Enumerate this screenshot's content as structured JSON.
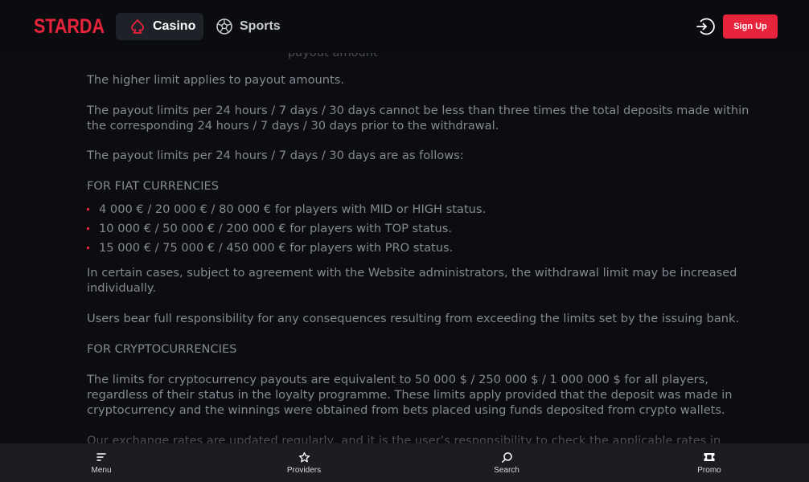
{
  "brand": {
    "logo_text": "STARDA",
    "accent": "#e8243c"
  },
  "header": {
    "tabs": [
      {
        "label": "Casino",
        "icon": "spade-icon",
        "active": true
      },
      {
        "label": "Sports",
        "icon": "soccer-ball-icon",
        "active": false
      }
    ],
    "login_icon": "login-icon",
    "signup_label": "Sign Up"
  },
  "content": {
    "partial_top_line": "payout amount",
    "p_higher_limit": "The higher limit applies to payout amounts.",
    "p_not_less_line1": "The payout limits per 24 hours / 7 days / 30 days cannot be less than three times the total deposits made within",
    "p_not_less_line2": "the corresponding 24 hours / 7 days / 30 days prior to the withdrawal.",
    "p_as_follows": "The payout limits per 24 hours / 7 days / 30 days are as follows:",
    "fiat_heading": "FOR FIAT CURRENCIES",
    "fiat_items": [
      "4 000 € / 20 000 € / 80 000 € for players with MID or HIGH status.",
      "10 000 € / 50 000 € / 200 000 € for players with TOP status.",
      "15 000 € / 75 000 € / 450 000 € for players with PRO status."
    ],
    "p_certain_cases_line1": "In certain cases, subject to agreement with the Website administrators, the withdrawal limit may be increased",
    "p_certain_cases_line2": "individually.",
    "p_users_bear": "Users bear full responsibility for any consequences resulting from exceeding the limits set by the issuing bank.",
    "crypto_heading": "FOR CRYPTOCURRENCIES",
    "p_crypto_line1": "The limits for cryptocurrency payouts are equivalent to 50 000 $ / 250 000 $ / 1 000 000 $ for all players,",
    "p_crypto_line2": "regardless of their status in the loyalty programme. These limits apply provided that the deposit was made in",
    "p_crypto_line3": "cryptocurrency and the winnings were obtained from bets placed using funds deposited from crypto wallets.",
    "p_exchange_partial": "Our exchange rates are updated regularly, and it is the user’s responsibility to check the applicable rates in"
  },
  "bottom_nav": {
    "items": [
      {
        "label": "Menu",
        "icon": "menu-icon"
      },
      {
        "label": "Providers",
        "icon": "star-icon"
      },
      {
        "label": "Search",
        "icon": "search-icon"
      },
      {
        "label": "Promo",
        "icon": "ticket-icon"
      }
    ]
  }
}
